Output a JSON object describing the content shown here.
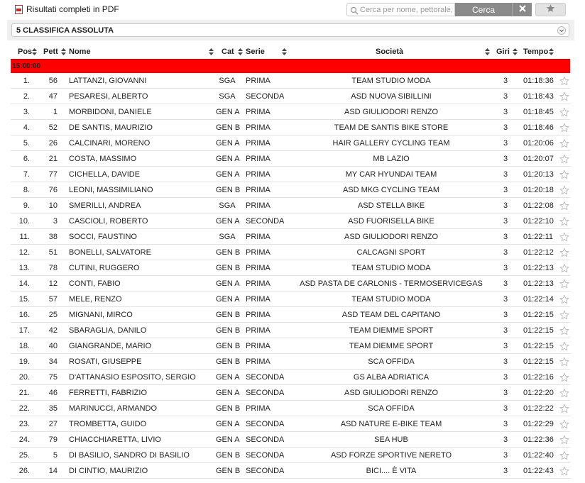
{
  "toolbar": {
    "pdf_label": "Risultati completi in PDF",
    "search_placeholder": "Cerca per nome, pettorale, società",
    "search_value": "",
    "search_button": "Cerca",
    "clear_icon": "close-icon",
    "favorite_icon": "star-icon"
  },
  "category_select": {
    "selected": "5 CLASSIFICA ASSOLUTA"
  },
  "table": {
    "headers": {
      "pos": "Pos",
      "pett": "Pett",
      "nome": "Nome",
      "cat": "Cat",
      "serie": "Serie",
      "societa": "Società",
      "giri": "Giri",
      "tempo": "Tempo"
    },
    "start_group": "15:00:00",
    "rows": [
      {
        "pos": "1.",
        "pett": "56",
        "nome": "LATTANZI, GIOVANNI",
        "cat": "SGA",
        "serie": "PRIMA",
        "societa": "TEAM STUDIO MODA",
        "giri": "3",
        "tempo": "01:18:36"
      },
      {
        "pos": "2.",
        "pett": "47",
        "nome": "PESARESI, ALBERTO",
        "cat": "SGA",
        "serie": "SECONDA",
        "societa": "ASD NUOVA SIBILLINI",
        "giri": "3",
        "tempo": "01:18:43"
      },
      {
        "pos": "3.",
        "pett": "1",
        "nome": "MORBIDONI, DANIELE",
        "cat": "GEN A",
        "serie": "PRIMA",
        "societa": "ASD GIULIODORI RENZO",
        "giri": "3",
        "tempo": "01:18:45"
      },
      {
        "pos": "4.",
        "pett": "52",
        "nome": "DE SANTIS, MAURIZIO",
        "cat": "GEN B",
        "serie": "PRIMA",
        "societa": "TEAM DE SANTIS BIKE STORE",
        "giri": "3",
        "tempo": "01:18:46"
      },
      {
        "pos": "5.",
        "pett": "26",
        "nome": "CALCINARI, MORENO",
        "cat": "GEN A",
        "serie": "PRIMA",
        "societa": "HAIR GALLERY CYCLING TEAM",
        "giri": "3",
        "tempo": "01:20:06"
      },
      {
        "pos": "6.",
        "pett": "21",
        "nome": "COSTA, MASSIMO",
        "cat": "GEN A",
        "serie": "PRIMA",
        "societa": "MB LAZIO",
        "giri": "3",
        "tempo": "01:20:07"
      },
      {
        "pos": "7.",
        "pett": "77",
        "nome": "CICHELLA, DAVIDE",
        "cat": "GEN A",
        "serie": "PRIMA",
        "societa": "MY CAR HYUNDAI TEAM",
        "giri": "3",
        "tempo": "01:20:13"
      },
      {
        "pos": "8.",
        "pett": "76",
        "nome": "LEONI, MASSIMILIANO",
        "cat": "GEN B",
        "serie": "PRIMA",
        "societa": "ASD MKG CYCLING TEAM",
        "giri": "3",
        "tempo": "01:20:18"
      },
      {
        "pos": "9.",
        "pett": "10",
        "nome": "SMERILLI, ANDREA",
        "cat": "SGA",
        "serie": "PRIMA",
        "societa": "ASD STELLA BIKE",
        "giri": "3",
        "tempo": "01:22:08"
      },
      {
        "pos": "10.",
        "pett": "3",
        "nome": "CASCIOLI, ROBERTO",
        "cat": "GEN A",
        "serie": "SECONDA",
        "societa": "ASD FUORISELLA BIKE",
        "giri": "3",
        "tempo": "01:22:10"
      },
      {
        "pos": "11.",
        "pett": "38",
        "nome": "SOCCI, FAUSTINO",
        "cat": "SGA",
        "serie": "PRIMA",
        "societa": "ASD GIULIODORI RENZO",
        "giri": "3",
        "tempo": "01:22:11"
      },
      {
        "pos": "12.",
        "pett": "51",
        "nome": "BONELLI, SALVATORE",
        "cat": "GEN B",
        "serie": "PRIMA",
        "societa": "CALCAGNI SPORT",
        "giri": "3",
        "tempo": "01:22:12"
      },
      {
        "pos": "13.",
        "pett": "78",
        "nome": "CUTINI, RUGGERO",
        "cat": "GEN B",
        "serie": "PRIMA",
        "societa": "TEAM STUDIO MODA",
        "giri": "3",
        "tempo": "01:22:13"
      },
      {
        "pos": "14.",
        "pett": "12",
        "nome": "CONTI, FABIO",
        "cat": "GEN A",
        "serie": "PRIMA",
        "societa": "ASD PASTA DE CARLONIS - TERMOSERVICEGAS",
        "giri": "3",
        "tempo": "01:22:13"
      },
      {
        "pos": "15.",
        "pett": "57",
        "nome": "MELE, RENZO",
        "cat": "GEN A",
        "serie": "PRIMA",
        "societa": "TEAM STUDIO MODA",
        "giri": "3",
        "tempo": "01:22:14"
      },
      {
        "pos": "16.",
        "pett": "25",
        "nome": "MIGNANI, MIRCO",
        "cat": "GEN B",
        "serie": "PRIMA",
        "societa": "ASD TEAM DEL CAPITANO",
        "giri": "3",
        "tempo": "01:22:15"
      },
      {
        "pos": "17.",
        "pett": "42",
        "nome": "SBARAGLIA, DANILO",
        "cat": "GEN B",
        "serie": "PRIMA",
        "societa": "TEAM DIEMME SPORT",
        "giri": "3",
        "tempo": "01:22:15"
      },
      {
        "pos": "18.",
        "pett": "40",
        "nome": "GIANGRANDE, MARIO",
        "cat": "GEN B",
        "serie": "PRIMA",
        "societa": "TEAM DIEMME SPORT",
        "giri": "3",
        "tempo": "01:22:15"
      },
      {
        "pos": "19.",
        "pett": "34",
        "nome": "ROSATI, GIUSEPPE",
        "cat": "GEN B",
        "serie": "PRIMA",
        "societa": "SCA OFFIDA",
        "giri": "3",
        "tempo": "01:22:15"
      },
      {
        "pos": "20.",
        "pett": "75",
        "nome": "D'ATTANASIO ESPOSITO, SERGIO",
        "cat": "GEN A",
        "serie": "SECONDA",
        "societa": "GS ALBA ADRIATICA",
        "giri": "3",
        "tempo": "01:22:16"
      },
      {
        "pos": "21.",
        "pett": "46",
        "nome": "FERRETTI, FABRIZIO",
        "cat": "GEN A",
        "serie": "SECONDA",
        "societa": "ASD GIULIODORI RENZO",
        "giri": "3",
        "tempo": "01:22:20"
      },
      {
        "pos": "22.",
        "pett": "35",
        "nome": "MARINUCCI, ARMANDO",
        "cat": "GEN B",
        "serie": "PRIMA",
        "societa": "SCA OFFIDA",
        "giri": "3",
        "tempo": "01:22:22"
      },
      {
        "pos": "23.",
        "pett": "27",
        "nome": "TROMBETTA, GUIDO",
        "cat": "GEN A",
        "serie": "SECONDA",
        "societa": "ASD NATURE E-BIKE TEAM",
        "giri": "3",
        "tempo": "01:22:29"
      },
      {
        "pos": "24.",
        "pett": "79",
        "nome": "CHIACCHIARETTA, LIVIO",
        "cat": "GEN A",
        "serie": "SECONDA",
        "societa": "SEA HUB",
        "giri": "3",
        "tempo": "01:22:36"
      },
      {
        "pos": "25.",
        "pett": "5",
        "nome": "DI BASILIO, SANDRO DI BASILIO",
        "cat": "GEN B",
        "serie": "SECONDA",
        "societa": "ASD FORZE SPORTIVE NERETO",
        "giri": "3",
        "tempo": "01:22:40"
      },
      {
        "pos": "26.",
        "pett": "14",
        "nome": "DI CINTIO, MAURIZIO",
        "cat": "GEN B",
        "serie": "SECONDA",
        "societa": "BICI.... È VITA",
        "giri": "3",
        "tempo": "01:22:43"
      }
    ]
  },
  "colors": {
    "start_group_bg": "#ff0000",
    "button_gray": "#8a8a8a",
    "pdf_red": "#c62828"
  }
}
